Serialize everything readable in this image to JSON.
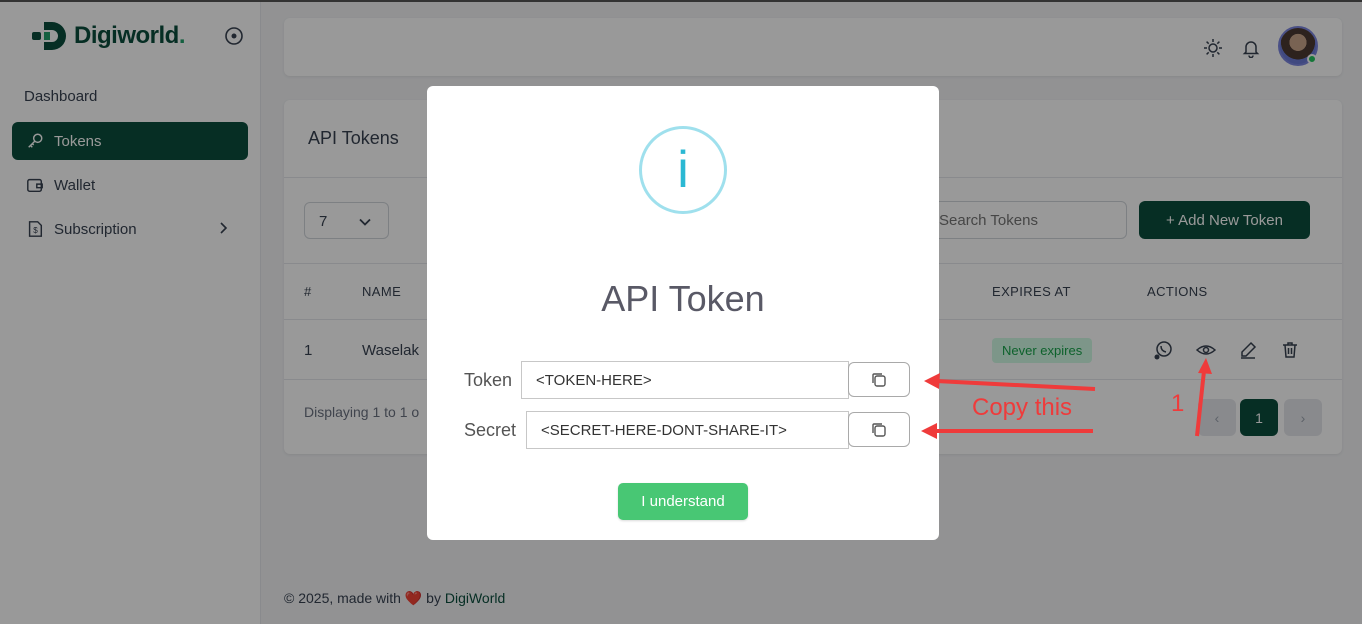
{
  "brand": {
    "name": "Digiworld",
    "dot": "."
  },
  "sidebar": {
    "section_title": "Dashboard",
    "items": [
      {
        "label": "Tokens",
        "icon": "key-icon",
        "active": true
      },
      {
        "label": "Wallet",
        "icon": "wallet-icon"
      },
      {
        "label": "Subscription",
        "icon": "receipt-icon",
        "has_submenu": true
      }
    ]
  },
  "header": {
    "icons": [
      "sun-icon",
      "bell-icon",
      "avatar"
    ]
  },
  "tokens_card": {
    "title": "API Tokens",
    "per_page": "7",
    "search_placeholder": "Search Tokens",
    "add_button": "+ Add New Token",
    "columns": [
      "#",
      "NAME",
      "EXPIRES AT",
      "ACTIONS"
    ],
    "rows": [
      {
        "index": "1",
        "name": "Waselak",
        "expires": "Never expires"
      }
    ],
    "display_info": "Displaying 1 to 1 o",
    "pagination": {
      "prev": "‹",
      "current": "1",
      "next": "›"
    }
  },
  "footer": {
    "prefix": "© 2025, made with",
    "heart": "❤️",
    "by": "by",
    "link": "DigiWorld"
  },
  "modal": {
    "icon_char": "i",
    "title": "API Token",
    "token_label": "Token",
    "token_value": "<TOKEN-HERE>",
    "secret_label": "Secret",
    "secret_value": "<SECRET-HERE-DONT-SHARE-IT>",
    "confirm_button": "I understand"
  },
  "annotations": {
    "copy_note": "Copy this",
    "step_number": "1"
  },
  "colors": {
    "brand": "#0b4d3c",
    "success": "#48c774",
    "info": "#2bb8d3",
    "annotation": "#ef3b3b"
  }
}
